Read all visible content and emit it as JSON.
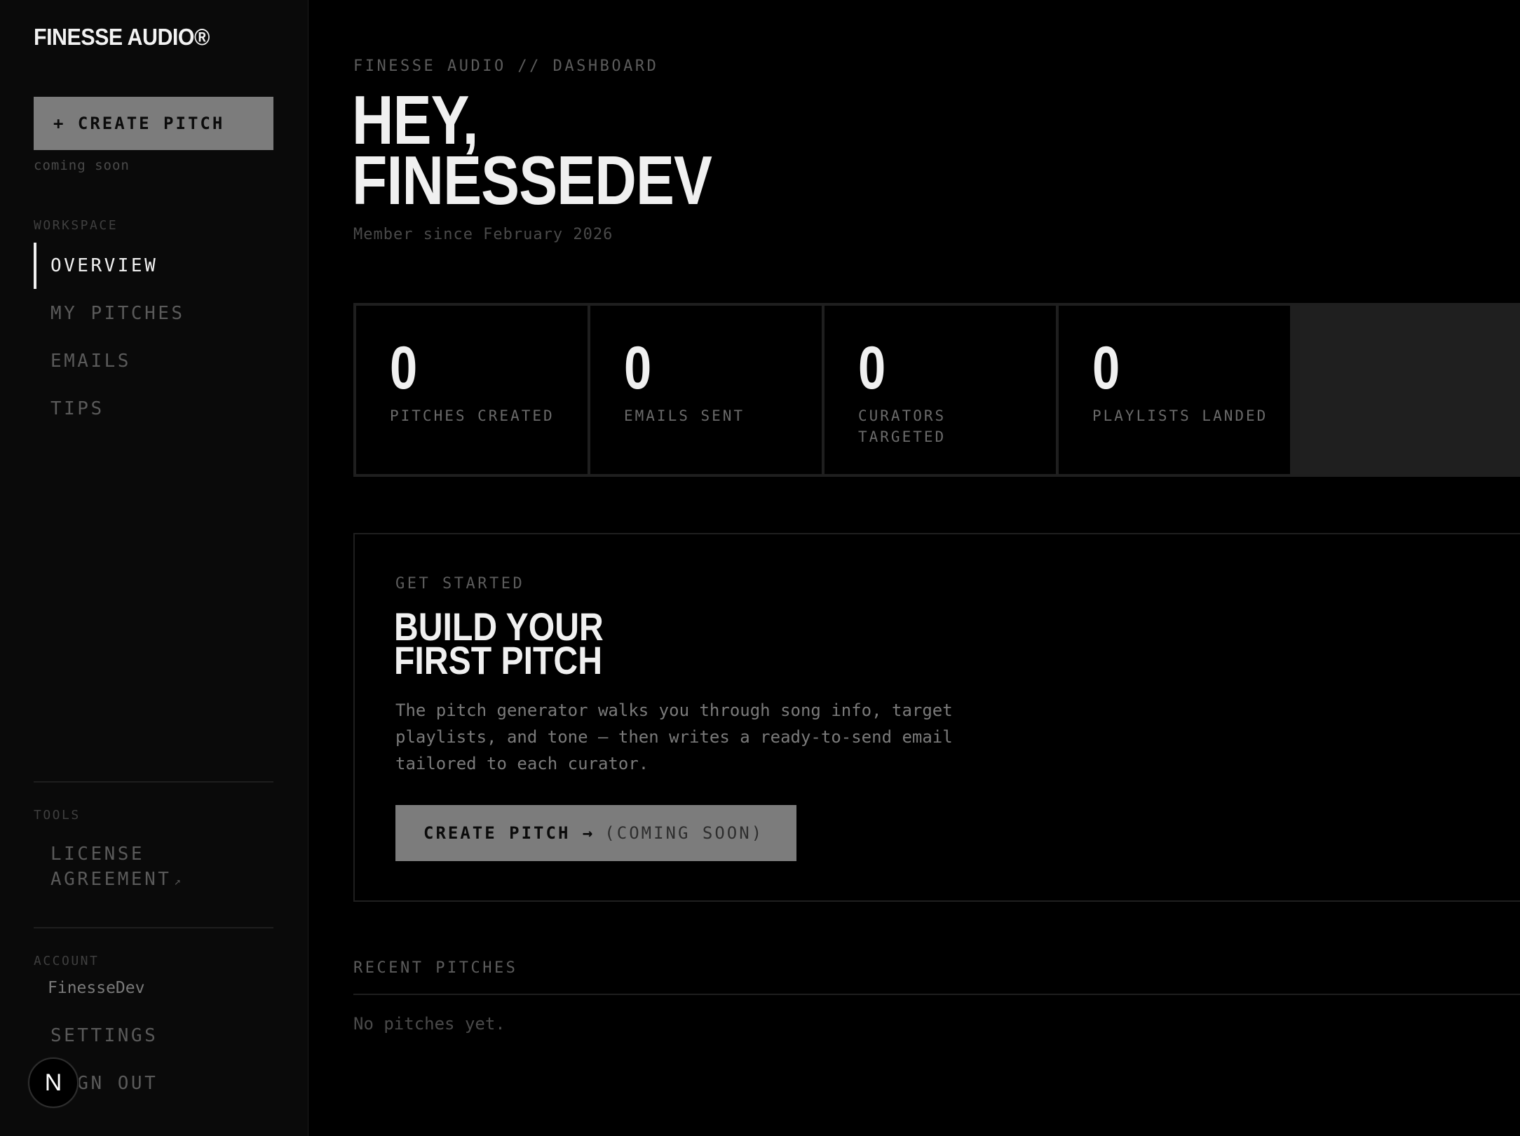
{
  "brand": "FINESSE AUDIO®",
  "sidebar": {
    "create_button": "+ CREATE PITCH",
    "create_note": "coming soon",
    "workspace_label": "WORKSPACE",
    "workspace_items": [
      {
        "label": "OVERVIEW",
        "active": true
      },
      {
        "label": "MY PITCHES"
      },
      {
        "label": "EMAILS"
      },
      {
        "label": "TIPS"
      }
    ],
    "tools_label": "TOOLS",
    "license_line1": "LICENSE",
    "license_line2": "AGREEMENT",
    "license_ext_icon": "↗",
    "account_label": "ACCOUNT",
    "account_name": "FinesseDev",
    "settings": "SETTINGS",
    "sign_out": "SIGN OUT",
    "badge_letter": "N"
  },
  "main": {
    "breadcrumb": "FINESSE AUDIO // DASHBOARD",
    "greeting_line1": "HEY,",
    "greeting_line2": "FINESSEDEV",
    "member_since": "Member since February 2026",
    "stats": [
      {
        "value": "0",
        "label": "PITCHES CREATED"
      },
      {
        "value": "0",
        "label": "EMAILS SENT"
      },
      {
        "value": "0",
        "label": "CURATORS TARGETED"
      },
      {
        "value": "0",
        "label": "PLAYLISTS LANDED"
      }
    ],
    "get_started": {
      "eyebrow": "GET STARTED",
      "title_line1": "BUILD YOUR",
      "title_line2": "FIRST PITCH",
      "description": "The pitch generator walks you through song info, target playlists, and tone — then writes a ready-to-send email tailored to each curator.",
      "button_strong": "CREATE PITCH →",
      "button_soft": "(COMING SOON)"
    },
    "recent": {
      "title": "RECENT PITCHES",
      "empty": "No pitches yet."
    }
  }
}
